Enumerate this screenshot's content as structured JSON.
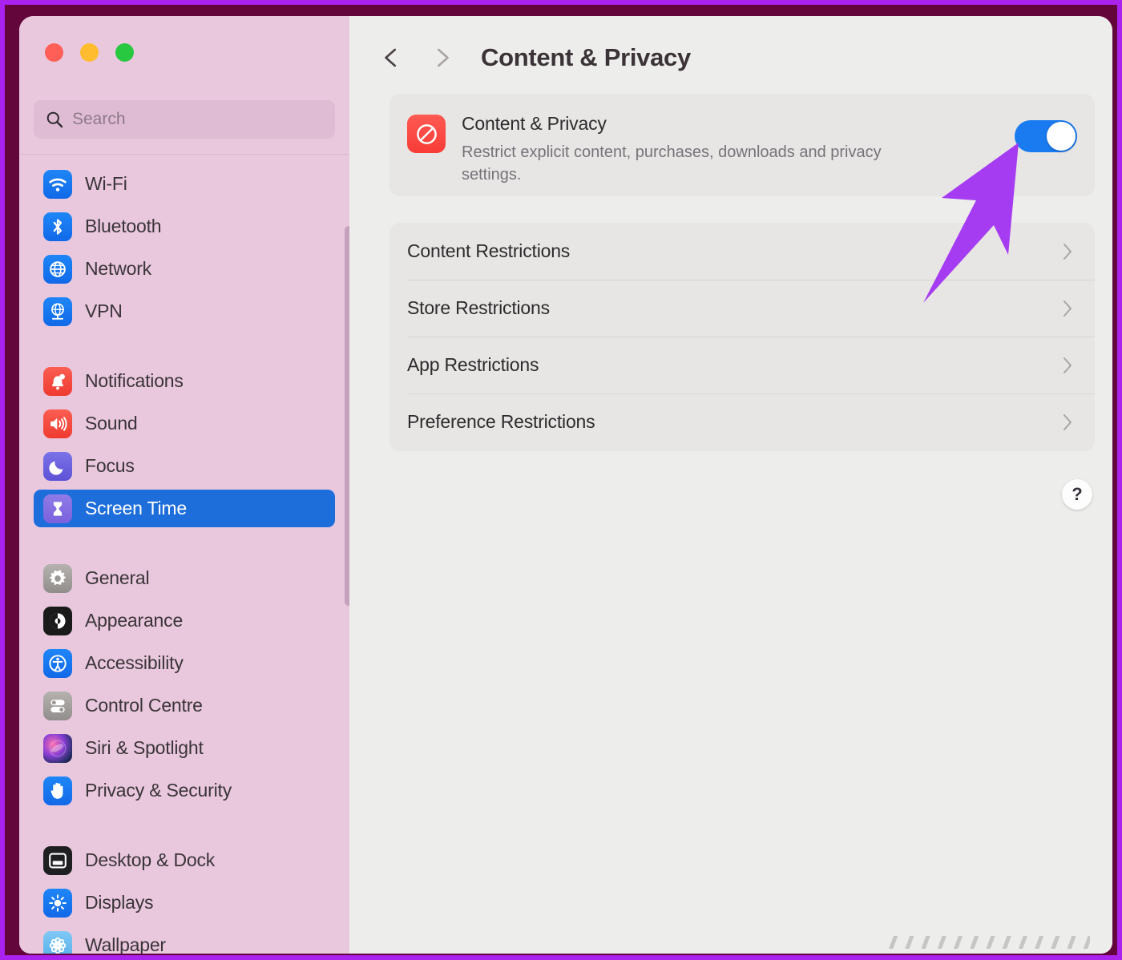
{
  "window": {
    "traffic_lights": [
      {
        "name": "close",
        "color": "#ff5f57"
      },
      {
        "name": "minimize",
        "color": "#febc2e"
      },
      {
        "name": "maximize",
        "color": "#28c840"
      }
    ]
  },
  "sidebar": {
    "search": {
      "value": "",
      "placeholder": "Search"
    },
    "groups": [
      {
        "items": [
          {
            "label": "Wi-Fi",
            "icon": "wifi-icon",
            "selected": false
          },
          {
            "label": "Bluetooth",
            "icon": "bluetooth-icon",
            "selected": false
          },
          {
            "label": "Network",
            "icon": "network-icon",
            "selected": false
          },
          {
            "label": "VPN",
            "icon": "vpn-icon",
            "selected": false
          }
        ]
      },
      {
        "items": [
          {
            "label": "Notifications",
            "icon": "bell-icon",
            "selected": false
          },
          {
            "label": "Sound",
            "icon": "speaker-icon",
            "selected": false
          },
          {
            "label": "Focus",
            "icon": "moon-icon",
            "selected": false
          },
          {
            "label": "Screen Time",
            "icon": "hourglass-icon",
            "selected": true
          }
        ]
      },
      {
        "items": [
          {
            "label": "General",
            "icon": "gear-icon",
            "selected": false
          },
          {
            "label": "Appearance",
            "icon": "appearance-icon",
            "selected": false
          },
          {
            "label": "Accessibility",
            "icon": "accessibility-icon",
            "selected": false
          },
          {
            "label": "Control Centre",
            "icon": "toggles-icon",
            "selected": false
          },
          {
            "label": "Siri & Spotlight",
            "icon": "siri-icon",
            "selected": false
          },
          {
            "label": "Privacy & Security",
            "icon": "hand-icon",
            "selected": false
          }
        ]
      },
      {
        "items": [
          {
            "label": "Desktop & Dock",
            "icon": "desktop-icon",
            "selected": false
          },
          {
            "label": "Displays",
            "icon": "brightness-icon",
            "selected": false
          },
          {
            "label": "Wallpaper",
            "icon": "wallpaper-icon",
            "selected": false
          }
        ]
      }
    ]
  },
  "toolbar": {
    "back_icon": "chevron-left-icon",
    "forward_icon": "chevron-right-icon",
    "title": "Content & Privacy"
  },
  "main": {
    "feature_card": {
      "icon": "prohibition-sign-icon",
      "title": "Content & Privacy",
      "subtitle": "Restrict explicit content, purchases, downloads and privacy settings.",
      "toggle": {
        "name": "content-privacy-toggle",
        "state": "on",
        "color": "#1a7bf0"
      }
    },
    "restrictions": [
      {
        "label": "Content Restrictions"
      },
      {
        "label": "Store Restrictions"
      },
      {
        "label": "App Restrictions"
      },
      {
        "label": "Preference Restrictions"
      }
    ],
    "help_button_label": "?"
  },
  "annotation": {
    "arrow_color": "#a63cf2",
    "points_to": "content-privacy-toggle"
  },
  "colors": {
    "outer_border": "#aa22ee",
    "inner_border": "#63063b",
    "sidebar_bg": "#e9c8de",
    "panel_bg": "#ededeb",
    "card_bg": "#e8e6e4",
    "selection_blue": "#1d6ddb"
  }
}
